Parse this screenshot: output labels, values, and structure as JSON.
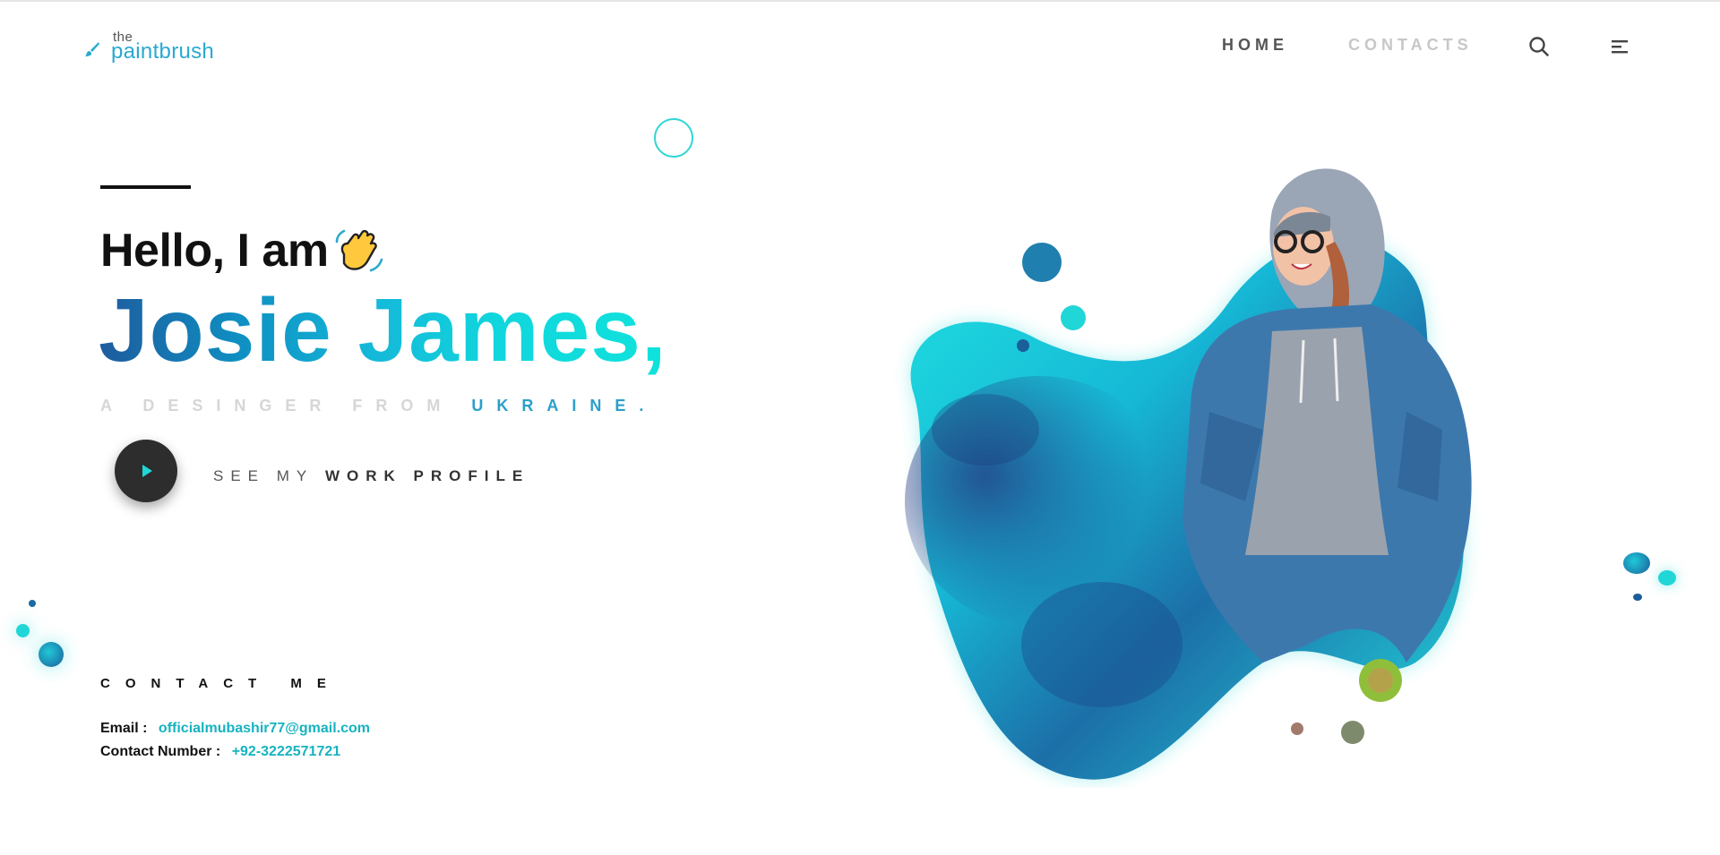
{
  "header": {
    "logo_the": "the",
    "logo_name": "paintbrush",
    "nav": [
      {
        "label": "HOME",
        "active": true
      },
      {
        "label": "CONTACTS",
        "active": false
      }
    ],
    "icons": [
      "search-icon",
      "menu-icon"
    ]
  },
  "hero": {
    "greeting": "Hello, I am",
    "greeting_emoji": "waving-hand-icon",
    "name": "Josie James,",
    "tagline_muted": "A DESINGER FROM",
    "tagline_accent": "UKRAINE.",
    "cta_light": "SEE MY",
    "cta_bold": "WORK PROFILE"
  },
  "contact": {
    "title": "CONTACT ME",
    "email_label": "Email :",
    "email": "officialmubashir77@gmail.com",
    "phone_label": "Contact Number :",
    "phone": "+92-3222571721"
  },
  "colors": {
    "accent": "#2aa9cf",
    "teal": "#17b3c0",
    "cyan": "#21d6d6",
    "dark": "#2d2d2d"
  }
}
